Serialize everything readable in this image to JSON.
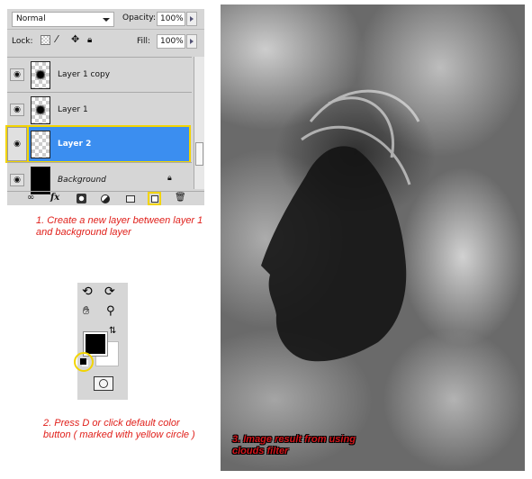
{
  "layers_panel": {
    "blend_mode": "Normal",
    "opacity_label": "Opacity:",
    "opacity": "100%",
    "lock_label": "Lock:",
    "fill_label": "Fill:",
    "fill": "100%",
    "layers": [
      {
        "name": "Layer 1 copy"
      },
      {
        "name": "Layer 1"
      },
      {
        "name": "Layer 2",
        "selected": true
      },
      {
        "name": "Background",
        "locked": true
      }
    ],
    "bottom_icons": [
      "link-icon",
      "fx-icon",
      "mask-icon",
      "adjustment-icon",
      "folder-icon",
      "new-layer-icon",
      "trash-icon"
    ],
    "fx_label": "fx"
  },
  "notes": {
    "step1": "1. Create a new layer between layer 1 and background layer",
    "step2": "2. Press D or click default color button ( marked with yellow circle )",
    "step3": "3. Image result from using clouds filter"
  },
  "colors": {
    "highlight": "#f2d400",
    "selection": "#3b8ef0",
    "note": "#e0201b"
  }
}
